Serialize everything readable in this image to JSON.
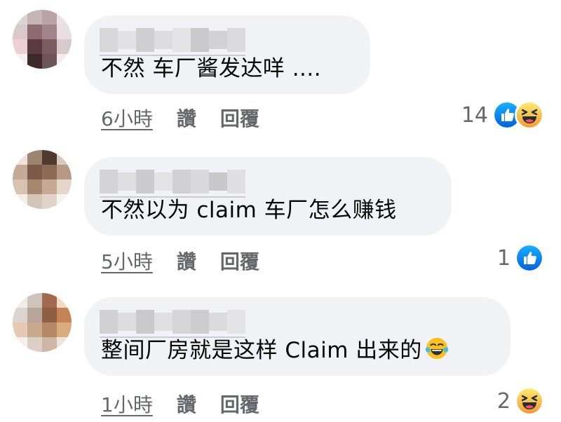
{
  "comments": [
    {
      "text": "不然 车厂酱发达咩 ....",
      "time": "6小時",
      "like_label": "讚",
      "reply_label": "回覆",
      "reaction_count": "14",
      "reactions": [
        "like-icon",
        "haha-icon"
      ]
    },
    {
      "text": "不然以为 claim 车厂怎么赚钱",
      "time": "5小時",
      "like_label": "讚",
      "reply_label": "回覆",
      "reaction_count": "1",
      "reactions": [
        "like-icon"
      ]
    },
    {
      "text": "整间厂房就是这样 Claim 出来的",
      "text_emoji": "tears-of-joy-emoji",
      "time": "1小時",
      "like_label": "讚",
      "reply_label": "回覆",
      "reaction_count": "2",
      "reactions": [
        "haha-icon"
      ]
    }
  ],
  "colors": {
    "bubble": "#f0f2f5",
    "meta_text": "#65676b",
    "body_text": "#050505",
    "like_blue": "#1877f2",
    "haha_yellow": "#f7b928"
  }
}
